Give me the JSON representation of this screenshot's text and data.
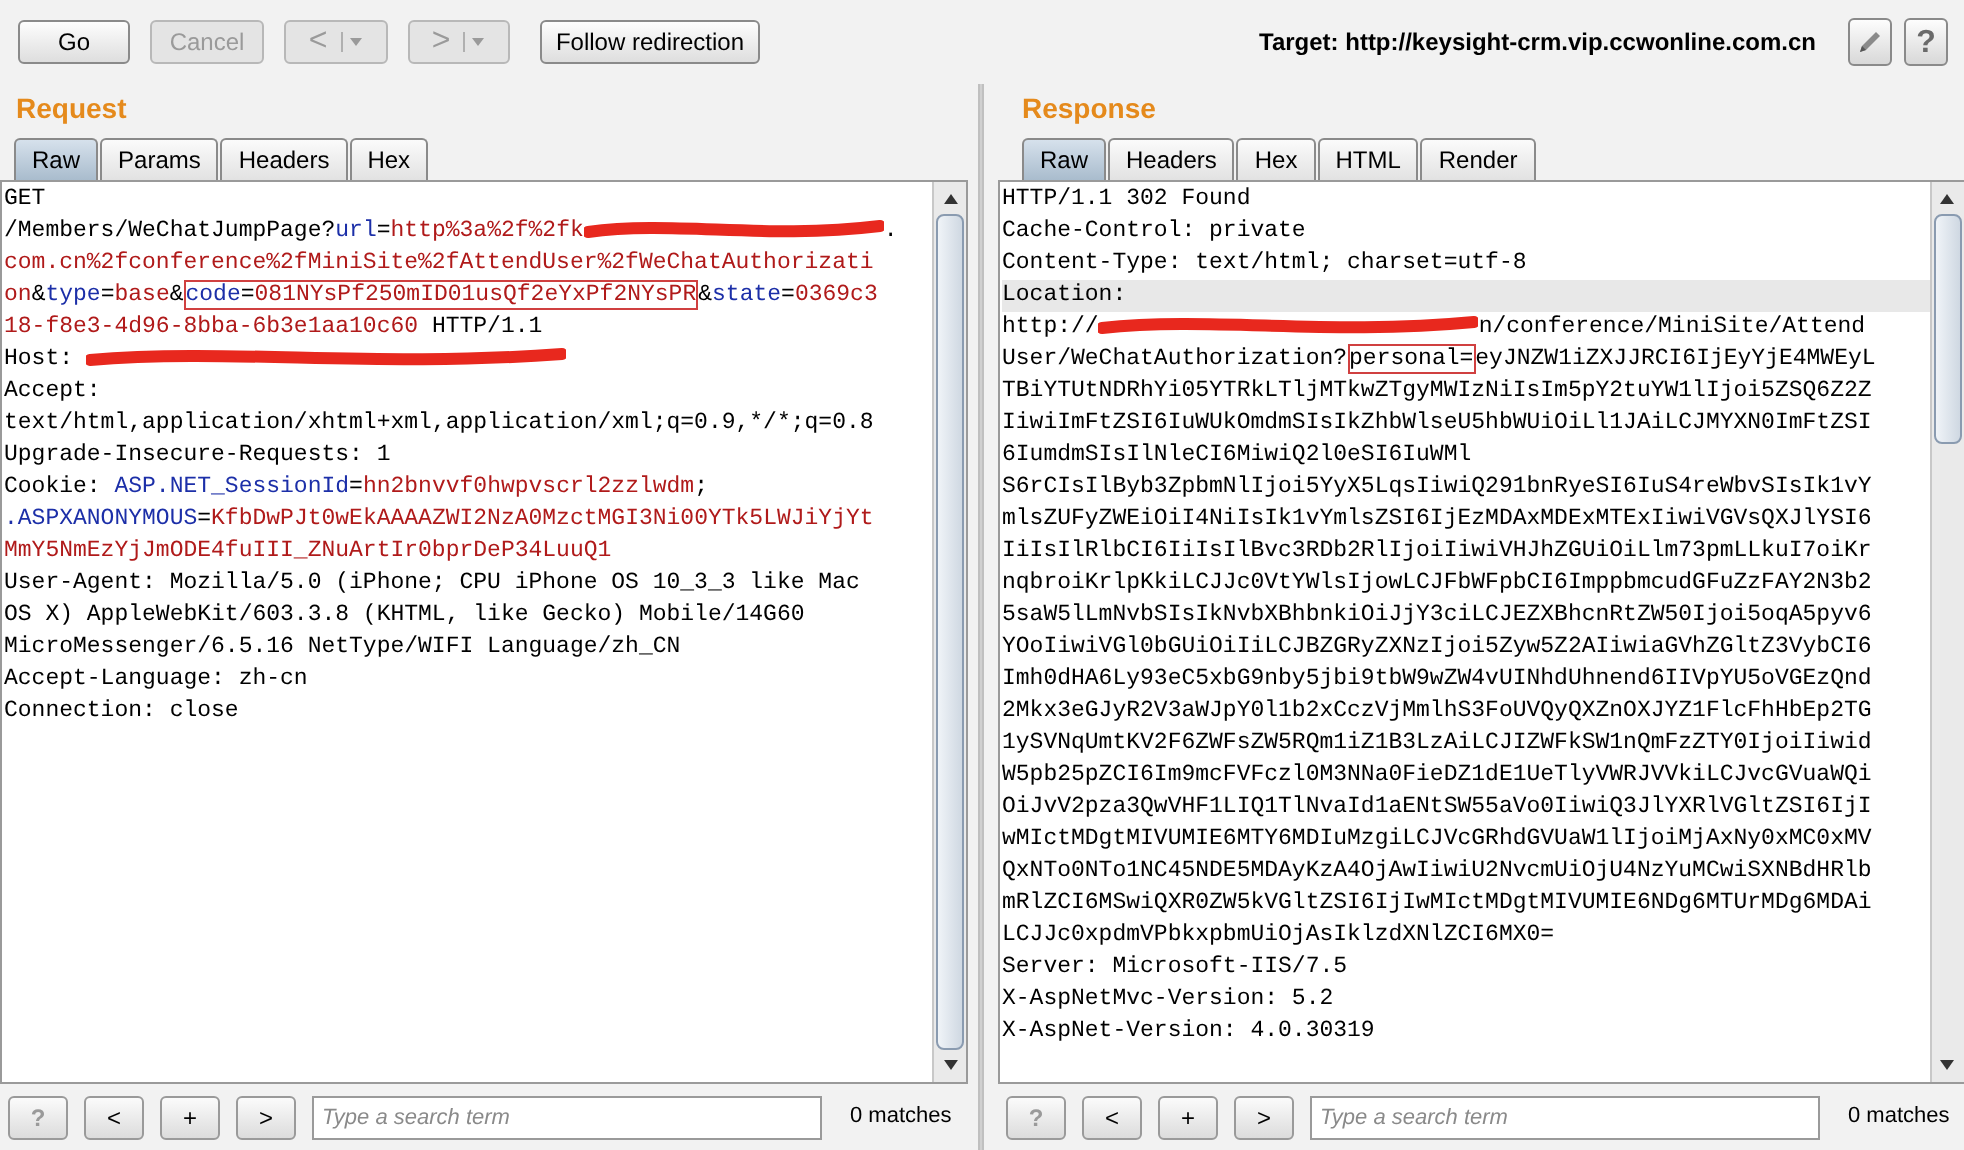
{
  "toolbar": {
    "buttons": [
      {
        "label": "Go",
        "kind": "button",
        "disabled": false
      },
      {
        "label": "Cancel",
        "kind": "button",
        "disabled": true
      },
      {
        "label": "<",
        "kind": "split",
        "disabled": true
      },
      {
        "label": ">",
        "kind": "split",
        "disabled": true
      },
      {
        "label": "Follow redirection",
        "kind": "button",
        "disabled": false
      }
    ],
    "target": "Target: http://keysight-crm.vip.ccwonline.com.cn",
    "help": "?"
  },
  "panes": [
    {
      "title": "Request",
      "tabs": [
        {
          "label": "Raw",
          "selected": true
        },
        {
          "label": "Params",
          "selected": false
        },
        {
          "label": "Headers",
          "selected": false
        },
        {
          "label": "Hex",
          "selected": false
        }
      ],
      "lines": [
        {
          "highlighted": false,
          "segs": [
            {
              "kind": "plain",
              "text": "GET"
            }
          ]
        },
        {
          "highlighted": false,
          "segs": [
            {
              "kind": "plain",
              "text": "/Members/WeChatJumpPage?"
            },
            {
              "kind": "name",
              "text": "url"
            },
            {
              "kind": "plain",
              "text": "="
            },
            {
              "kind": "value",
              "text": "http%3a%2f%2fk"
            },
            {
              "kind": "redaction"
            },
            {
              "kind": "plain",
              "text": "."
            }
          ]
        },
        {
          "highlighted": false,
          "segs": [
            {
              "kind": "value",
              "text": "com.cn%2fconference%2fMiniSite%2fAttendUser%2fWeChatAuthorizati"
            }
          ]
        },
        {
          "highlighted": false,
          "segs": [
            {
              "kind": "value",
              "text": "on"
            },
            {
              "kind": "plain",
              "text": "&"
            },
            {
              "kind": "name",
              "text": "type"
            },
            {
              "kind": "plain",
              "text": "="
            },
            {
              "kind": "value",
              "text": "base"
            },
            {
              "kind": "plain",
              "text": "&"
            },
            {
              "kind": "box",
              "parts": [
                {
                  "kind": "name",
                  "text": "code"
                },
                {
                  "kind": "plain",
                  "text": "="
                },
                {
                  "kind": "value",
                  "text": "081NYsPf250mID01usQf2eYxPf2NYsPR"
                }
              ]
            },
            {
              "kind": "plain",
              "text": "&"
            },
            {
              "kind": "name",
              "text": "state"
            },
            {
              "kind": "plain",
              "text": "="
            },
            {
              "kind": "value",
              "text": "0369c3"
            }
          ]
        },
        {
          "highlighted": false,
          "segs": [
            {
              "kind": "value",
              "text": "18-f8e3-4d96-8bba-6b3e1aa10c60"
            },
            {
              "kind": "plain",
              "text": " HTTP/1.1"
            }
          ]
        },
        {
          "highlighted": false,
          "segs": [
            {
              "kind": "plain",
              "text": "Host: "
            },
            {
              "kind": "redaction"
            }
          ]
        },
        {
          "highlighted": false,
          "segs": [
            {
              "kind": "plain",
              "text": "Accept:"
            }
          ]
        },
        {
          "highlighted": false,
          "segs": [
            {
              "kind": "plain",
              "text": "text/html,application/xhtml+xml,application/xml;q=0.9,*/*;q=0.8"
            }
          ]
        },
        {
          "highlighted": false,
          "segs": [
            {
              "kind": "plain",
              "text": "Upgrade-Insecure-Requests: 1"
            }
          ]
        },
        {
          "highlighted": false,
          "segs": [
            {
              "kind": "plain",
              "text": "Cookie: "
            },
            {
              "kind": "name",
              "text": "ASP.NET_SessionId"
            },
            {
              "kind": "plain",
              "text": "="
            },
            {
              "kind": "value",
              "text": "hn2bnvvf0hwpvscrl2zzlwdm"
            },
            {
              "kind": "plain",
              "text": ";"
            }
          ]
        },
        {
          "highlighted": false,
          "segs": [
            {
              "kind": "name",
              "text": ".ASPXANONYMOUS"
            },
            {
              "kind": "plain",
              "text": "="
            },
            {
              "kind": "value",
              "text": "KfbDwPJt0wEkAAAAZWI2NzA0MzctMGI3Ni00YTk5LWJiYjYt"
            }
          ]
        },
        {
          "highlighted": false,
          "segs": [
            {
              "kind": "value",
              "text": "MmY5NmEzYjJmODE4fuIII_ZNuArtIr0bprDeP34LuuQ1"
            }
          ]
        },
        {
          "highlighted": false,
          "segs": [
            {
              "kind": "plain",
              "text": "User-Agent: Mozilla/5.0 (iPhone; CPU iPhone OS 10_3_3 like Mac"
            }
          ]
        },
        {
          "highlighted": false,
          "segs": [
            {
              "kind": "plain",
              "text": "OS X) AppleWebKit/603.3.8 (KHTML, like Gecko) Mobile/14G60"
            }
          ]
        },
        {
          "highlighted": false,
          "segs": [
            {
              "kind": "plain",
              "text": "MicroMessenger/6.5.16 NetType/WIFI Language/zh_CN"
            }
          ]
        },
        {
          "highlighted": false,
          "segs": [
            {
              "kind": "plain",
              "text": "Accept-Language: zh-cn"
            }
          ]
        },
        {
          "highlighted": false,
          "segs": [
            {
              "kind": "plain",
              "text": "Connection: close"
            }
          ]
        }
      ],
      "search": {
        "buttons": [
          "?",
          "<",
          "+",
          ">"
        ],
        "placeholder": "Type a search term",
        "matches": "0 matches"
      }
    },
    {
      "title": "Response",
      "tabs": [
        {
          "label": "Raw",
          "selected": true
        },
        {
          "label": "Headers",
          "selected": false
        },
        {
          "label": "Hex",
          "selected": false
        },
        {
          "label": "HTML",
          "selected": false
        },
        {
          "label": "Render",
          "selected": false
        }
      ],
      "lines": [
        {
          "highlighted": false,
          "segs": [
            {
              "kind": "plain",
              "text": "HTTP/1.1 302 Found"
            }
          ]
        },
        {
          "highlighted": false,
          "segs": [
            {
              "kind": "plain",
              "text": "Cache-Control: private"
            }
          ]
        },
        {
          "highlighted": false,
          "segs": [
            {
              "kind": "plain",
              "text": "Content-Type: text/html; charset=utf-8"
            }
          ]
        },
        {
          "highlighted": true,
          "segs": [
            {
              "kind": "plain",
              "text": "Location:"
            }
          ]
        },
        {
          "highlighted": false,
          "segs": [
            {
              "kind": "plain",
              "text": "http://"
            },
            {
              "kind": "redaction"
            },
            {
              "kind": "plain",
              "text": "n/conference/MiniSite/Attend"
            }
          ]
        },
        {
          "highlighted": false,
          "segs": [
            {
              "kind": "plain",
              "text": "User/WeChatAuthorization?"
            },
            {
              "kind": "box",
              "parts": [
                {
                  "kind": "plain",
                  "text": "personal="
                }
              ]
            },
            {
              "kind": "plain",
              "text": "eyJNZW1iZXJJRCI6IjEyYjE4MWEyL"
            }
          ]
        },
        {
          "highlighted": false,
          "segs": [
            {
              "kind": "plain",
              "text": "TBiYTUtNDRhYi05YTRkLTljMTkwZTgyMWIzNiIsIm5pY2tuYW1lIjoi5ZSQ6Z2Z"
            }
          ]
        },
        {
          "highlighted": false,
          "segs": [
            {
              "kind": "plain",
              "text": "IiwiImFtZSI6IuWUkOmdmSIsIkZhbWlseU5hbWUiOiLl1JAiLCJMYXN0ImFtZSI"
            }
          ]
        },
        {
          "highlighted": false,
          "segs": [
            {
              "kind": "plain",
              "text": "6IumdmSIsIlNleCI6MiwiQ2l0eSI6IuWMl"
            }
          ]
        },
        {
          "highlighted": false,
          "segs": [
            {
              "kind": "plain",
              "text": "S6rCIsIlByb3ZpbmNlIjoi5YyX5LqsIiwiQ291bnRyeSI6IuS4reWbvSIsIk1vY"
            }
          ]
        },
        {
          "highlighted": false,
          "segs": [
            {
              "kind": "plain",
              "text": "mlsZUFyZWEiOiI4NiIsIk1vYmlsZSI6IjEzMDAxMDExMTExIiwiVGVsQXJlYSI6"
            }
          ]
        },
        {
          "highlighted": false,
          "segs": [
            {
              "kind": "plain",
              "text": "IiIsIlRlbCI6IiIsIlBvc3RDb2RlIjoiIiwiVHJhZGUiOiLlm73pmLLkuI7oiKr"
            }
          ]
        },
        {
          "highlighted": false,
          "segs": [
            {
              "kind": "plain",
              "text": "nqbroiKrlpKkiLCJJc0VtYWlsIjowLCJFbWFpbCI6ImppbmcudGFuZzFAY2N3b2"
            }
          ]
        },
        {
          "highlighted": false,
          "segs": [
            {
              "kind": "plain",
              "text": "5saW5lLmNvbSIsIkNvbXBhbnkiOiJjY3ciLCJEZXBhcnRtZW50Ijoi5oqA5pyv6"
            }
          ]
        },
        {
          "highlighted": false,
          "segs": [
            {
              "kind": "plain",
              "text": "YOoIiwiVGl0bGUiOiIiLCJBZGRyZXNzIjoi5Zyw5Z2AIiwiaGVhZGltZ3VybCI6"
            }
          ]
        },
        {
          "highlighted": false,
          "segs": [
            {
              "kind": "plain",
              "text": "Imh0dHA6Ly93eC5xbG9nby5jbi9tbW9wZW4vUINhdUhnend6IIVpYU5oVGEzQnd"
            }
          ]
        },
        {
          "highlighted": false,
          "segs": [
            {
              "kind": "plain",
              "text": "2Mkx3eGJyR2V3aWJpY0l1b2xCczVjMmlhS3FoUVQyQXZnOXJYZ1FlcFhHbEp2TG"
            }
          ]
        },
        {
          "highlighted": false,
          "segs": [
            {
              "kind": "plain",
              "text": "1ySVNqUmtKV2F6ZWFsZW5RQm1iZ1B3LzAiLCJIZWFkSW1nQmFzZTY0IjoiIiwid"
            }
          ]
        },
        {
          "highlighted": false,
          "segs": [
            {
              "kind": "plain",
              "text": "W5pb25pZCI6Im9mcFVFczl0M3NNa0FieDZ1dE1UeTlyVWRJVVkiLCJvcGVuaWQi"
            }
          ]
        },
        {
          "highlighted": false,
          "segs": [
            {
              "kind": "plain",
              "text": "OiJvV2pza3QwVHF1LIQ1TlNvaId1aENtSW55aVo0IiwiQ3JlYXRlVGltZSI6IjI"
            }
          ]
        },
        {
          "highlighted": false,
          "segs": [
            {
              "kind": "plain",
              "text": "wMIctMDgtMIVUMIE6MTY6MDIuMzgiLCJVcGRhdGVUaW1lIjoiMjAxNy0xMC0xMV"
            }
          ]
        },
        {
          "highlighted": false,
          "segs": [
            {
              "kind": "plain",
              "text": "QxNTo0NTo1NC45NDE5MDAyKzA4OjAwIiwiU2NvcmUiOjU4NzYuMCwiSXNBdHRlb"
            }
          ]
        },
        {
          "highlighted": false,
          "segs": [
            {
              "kind": "plain",
              "text": "mRlZCI6MSwiQXR0ZW5kVGltZSI6IjIwMIctMDgtMIVUMIE6NDg6MTUrMDg6MDAi"
            }
          ]
        },
        {
          "highlighted": false,
          "segs": [
            {
              "kind": "plain",
              "text": "LCJJc0xpdmVPbkxpbmUiOjAsIklzdXNlZCI6MX0="
            }
          ]
        },
        {
          "highlighted": false,
          "segs": [
            {
              "kind": "plain",
              "text": "Server: Microsoft-IIS/7.5"
            }
          ]
        },
        {
          "highlighted": false,
          "segs": [
            {
              "kind": "plain",
              "text": "X-AspNetMvc-Version: 5.2"
            }
          ]
        },
        {
          "highlighted": false,
          "segs": [
            {
              "kind": "plain",
              "text": "X-AspNet-Version: 4.0.30319"
            }
          ]
        }
      ],
      "search": {
        "buttons": [
          "?",
          "<",
          "+",
          ">"
        ],
        "placeholder": "Type a search term",
        "matches": "0 matches"
      }
    }
  ]
}
